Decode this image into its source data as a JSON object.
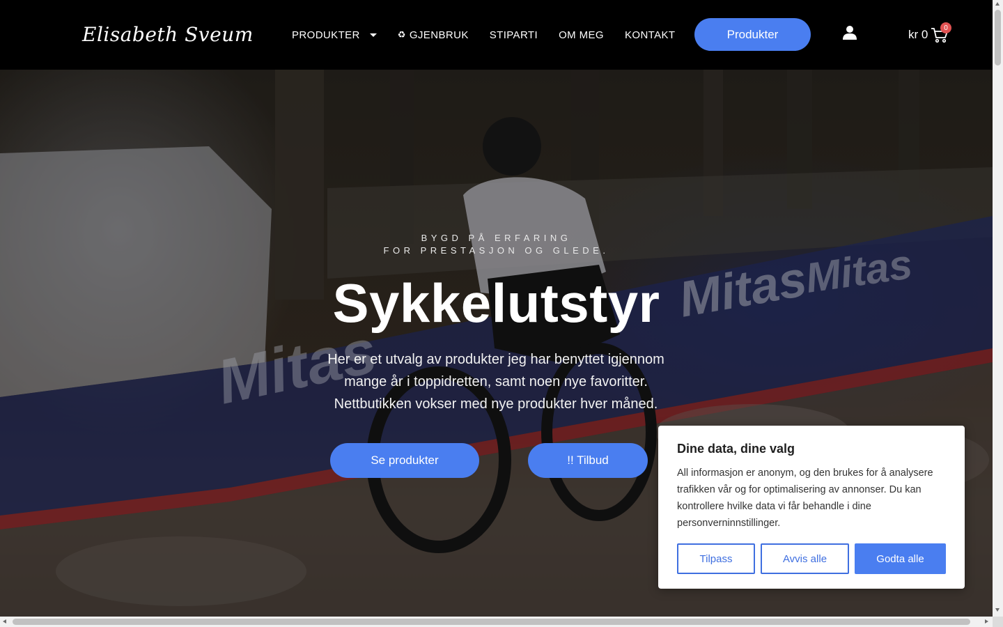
{
  "header": {
    "logo_text": "Elisabeth Sveum",
    "nav": [
      {
        "label": "PRODUKTER",
        "has_dropdown": true
      },
      {
        "label": "GJENBRUK",
        "icon": "recycle-icon"
      },
      {
        "label": "STIPARTI"
      },
      {
        "label": "OM MEG"
      },
      {
        "label": "KONTAKT"
      }
    ],
    "cta_label": "Produkter",
    "user_icon": "user-icon",
    "cart": {
      "total": "kr 0",
      "count": "0",
      "icon": "cart-icon"
    }
  },
  "hero": {
    "eyebrow_line1": "BYGD PÅ ERFARING",
    "eyebrow_line2": "FOR PRESTASJON OG GLEDE.",
    "title": "Sykkelutstyr",
    "text": "Her er et utvalg av produkter jeg har benyttet igjennom mange år i toppidretten, samt noen nye favoritter. Nettbutikken vokser med nye produkter hver måned.",
    "button_primary": "Se produkter",
    "button_secondary": "!! Tilbud",
    "banner_text": "Mitas"
  },
  "cookie_dialog": {
    "title": "Dine data, dine valg",
    "body": "All informasjon er anonym, og den brukes for å analysere trafikken vår og for optimalisering av annonser. Du kan kontrollere hvilke data vi får behandle i dine personverninnstillinger.",
    "btn_customize": "Tilpass",
    "btn_reject": "Avvis alle",
    "btn_accept": "Godta alle"
  },
  "colors": {
    "accent": "#4a7ef0",
    "header_bg": "#000000",
    "badge": "#e05252"
  }
}
